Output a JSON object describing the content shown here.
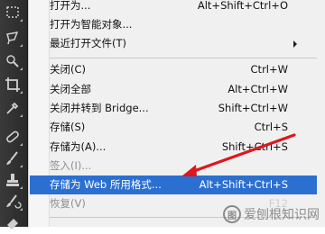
{
  "menu": {
    "items": [
      {
        "label": "打开为...",
        "shortcut": "Alt+Shift+Ctrl+O"
      },
      {
        "label": "打开为智能对象...",
        "shortcut": ""
      },
      {
        "label": "最近打开文件(T)",
        "shortcut": ""
      },
      {
        "label": "关闭(C)",
        "shortcut": "Ctrl+W"
      },
      {
        "label": "关闭全部",
        "shortcut": "Alt+Ctrl+W"
      },
      {
        "label": "关闭并转到 Bridge...",
        "shortcut": "Shift+Ctrl+W"
      },
      {
        "label": "存储(S)",
        "shortcut": "Ctrl+S"
      },
      {
        "label": "存储为(A)...",
        "shortcut": "Shift+Ctrl+S"
      },
      {
        "label": "签入(I)...",
        "shortcut": ""
      },
      {
        "label": "存储为 Web 所用格式...",
        "shortcut": "Alt+Shift+Ctrl+S"
      },
      {
        "label": "恢复(V)",
        "shortcut": "F12"
      }
    ]
  },
  "watermark": {
    "text": "爱刨根知识网",
    "logo": "图"
  },
  "colors": {
    "highlight": "#2b6fd1",
    "arrow": "#e0161b",
    "toolbar": "#2f2f2f"
  }
}
